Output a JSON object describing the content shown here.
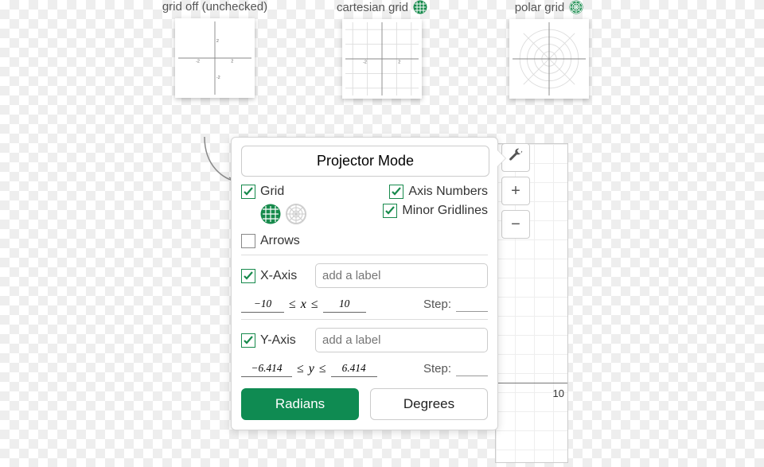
{
  "top": {
    "examples": [
      {
        "caption": "grid off (unchecked)",
        "icon": null
      },
      {
        "caption": "cartesian grid",
        "icon": "cartesian"
      },
      {
        "caption": "polar grid",
        "icon": "polar"
      }
    ]
  },
  "panel": {
    "projector_label": "Projector Mode",
    "grid_label": "Grid",
    "grid_checked": true,
    "axis_numbers_label": "Axis Numbers",
    "axis_numbers_checked": true,
    "minor_gridlines_label": "Minor Gridlines",
    "minor_gridlines_checked": true,
    "arrows_label": "Arrows",
    "arrows_checked": false,
    "xaxis_label": "X-Axis",
    "xaxis_checked": true,
    "xaxis_placeholder": "add a label",
    "x_min": "−10",
    "x_var": "x",
    "x_max": "10",
    "leq": "≤",
    "step_label": "Step:",
    "x_step": "",
    "yaxis_label": "Y-Axis",
    "yaxis_checked": true,
    "yaxis_placeholder": "add a label",
    "y_min": "−6.414",
    "y_var": "y",
    "y_max": "6.414",
    "y_step": "",
    "radians_label": "Radians",
    "degrees_label": "Degrees",
    "active_unit": "radians"
  },
  "canvas": {
    "tick": "10"
  },
  "icons": {
    "wrench": "🔧",
    "plus": "+",
    "minus": "−"
  },
  "colors": {
    "green": "#178a4c"
  }
}
